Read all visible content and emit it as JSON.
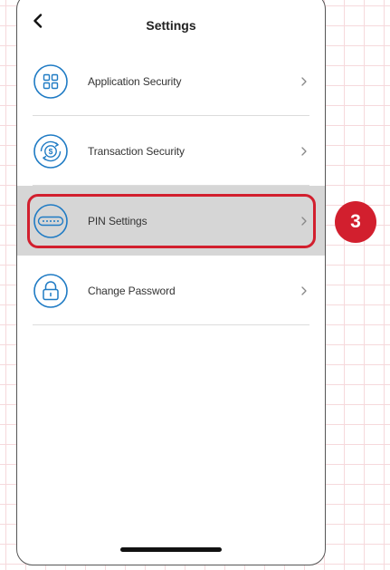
{
  "header": {
    "title": "Settings",
    "back_icon": "back-chevron-icon"
  },
  "menu": {
    "items": [
      {
        "label": "Application Security",
        "icon": "app-grid-icon",
        "selected": false
      },
      {
        "label": "Transaction Security",
        "icon": "money-cycle-icon",
        "selected": false
      },
      {
        "label": "PIN Settings",
        "icon": "pin-field-icon",
        "selected": true
      },
      {
        "label": "Change Password",
        "icon": "padlock-icon",
        "selected": false
      }
    ],
    "chevron_glyph": ">"
  },
  "annotation": {
    "step": "3",
    "color": "#d21f2e"
  },
  "colors": {
    "icon_stroke": "#1f7bc4",
    "selected_row": "#d6d6d6",
    "highlight": "#d21f2e"
  }
}
